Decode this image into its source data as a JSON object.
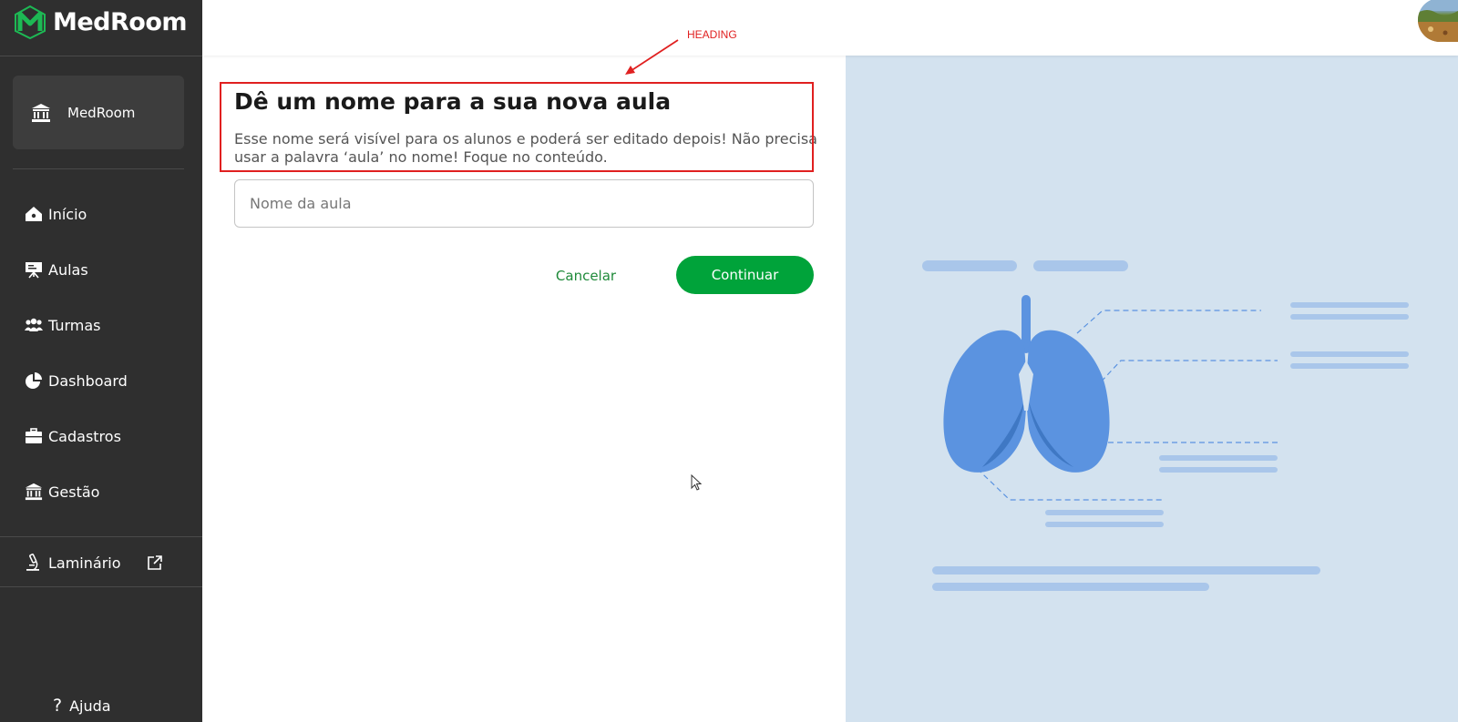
{
  "app": {
    "logo_text": "MedRoom",
    "org_name": "MedRoom"
  },
  "sidebar": {
    "items": [
      {
        "label": "Início",
        "icon": "home-icon"
      },
      {
        "label": "Aulas",
        "icon": "presentation-icon"
      },
      {
        "label": "Turmas",
        "icon": "group-icon"
      },
      {
        "label": "Dashboard",
        "icon": "pie-chart-icon"
      },
      {
        "label": "Cadastros",
        "icon": "briefcase-icon"
      },
      {
        "label": "Gestão",
        "icon": "institution-icon"
      }
    ],
    "laminario": {
      "label": "Laminário",
      "icon": "microscope-icon",
      "trailing_icon": "external-link-icon"
    },
    "help": {
      "label": "Ajuda",
      "glyph": "?"
    }
  },
  "annotation": {
    "label": "HEADING",
    "color": "#e02020"
  },
  "form": {
    "title": "Dê um nome para a sua nova aula",
    "description": "Esse nome será visível para os alunos e poderá ser editado depois! Não precisa usar a palavra ‘aula’ no nome! Foque no conteúdo.",
    "name_field": {
      "placeholder": "Nome da aula",
      "value": ""
    },
    "cancel_label": "Cancelar",
    "continue_label": "Continuar"
  },
  "colors": {
    "sidebar_bg": "#2f2f2f",
    "brand_green": "#00a33a",
    "illustration_bg": "#d3e2ef",
    "lung_blue": "#5b93e0"
  }
}
